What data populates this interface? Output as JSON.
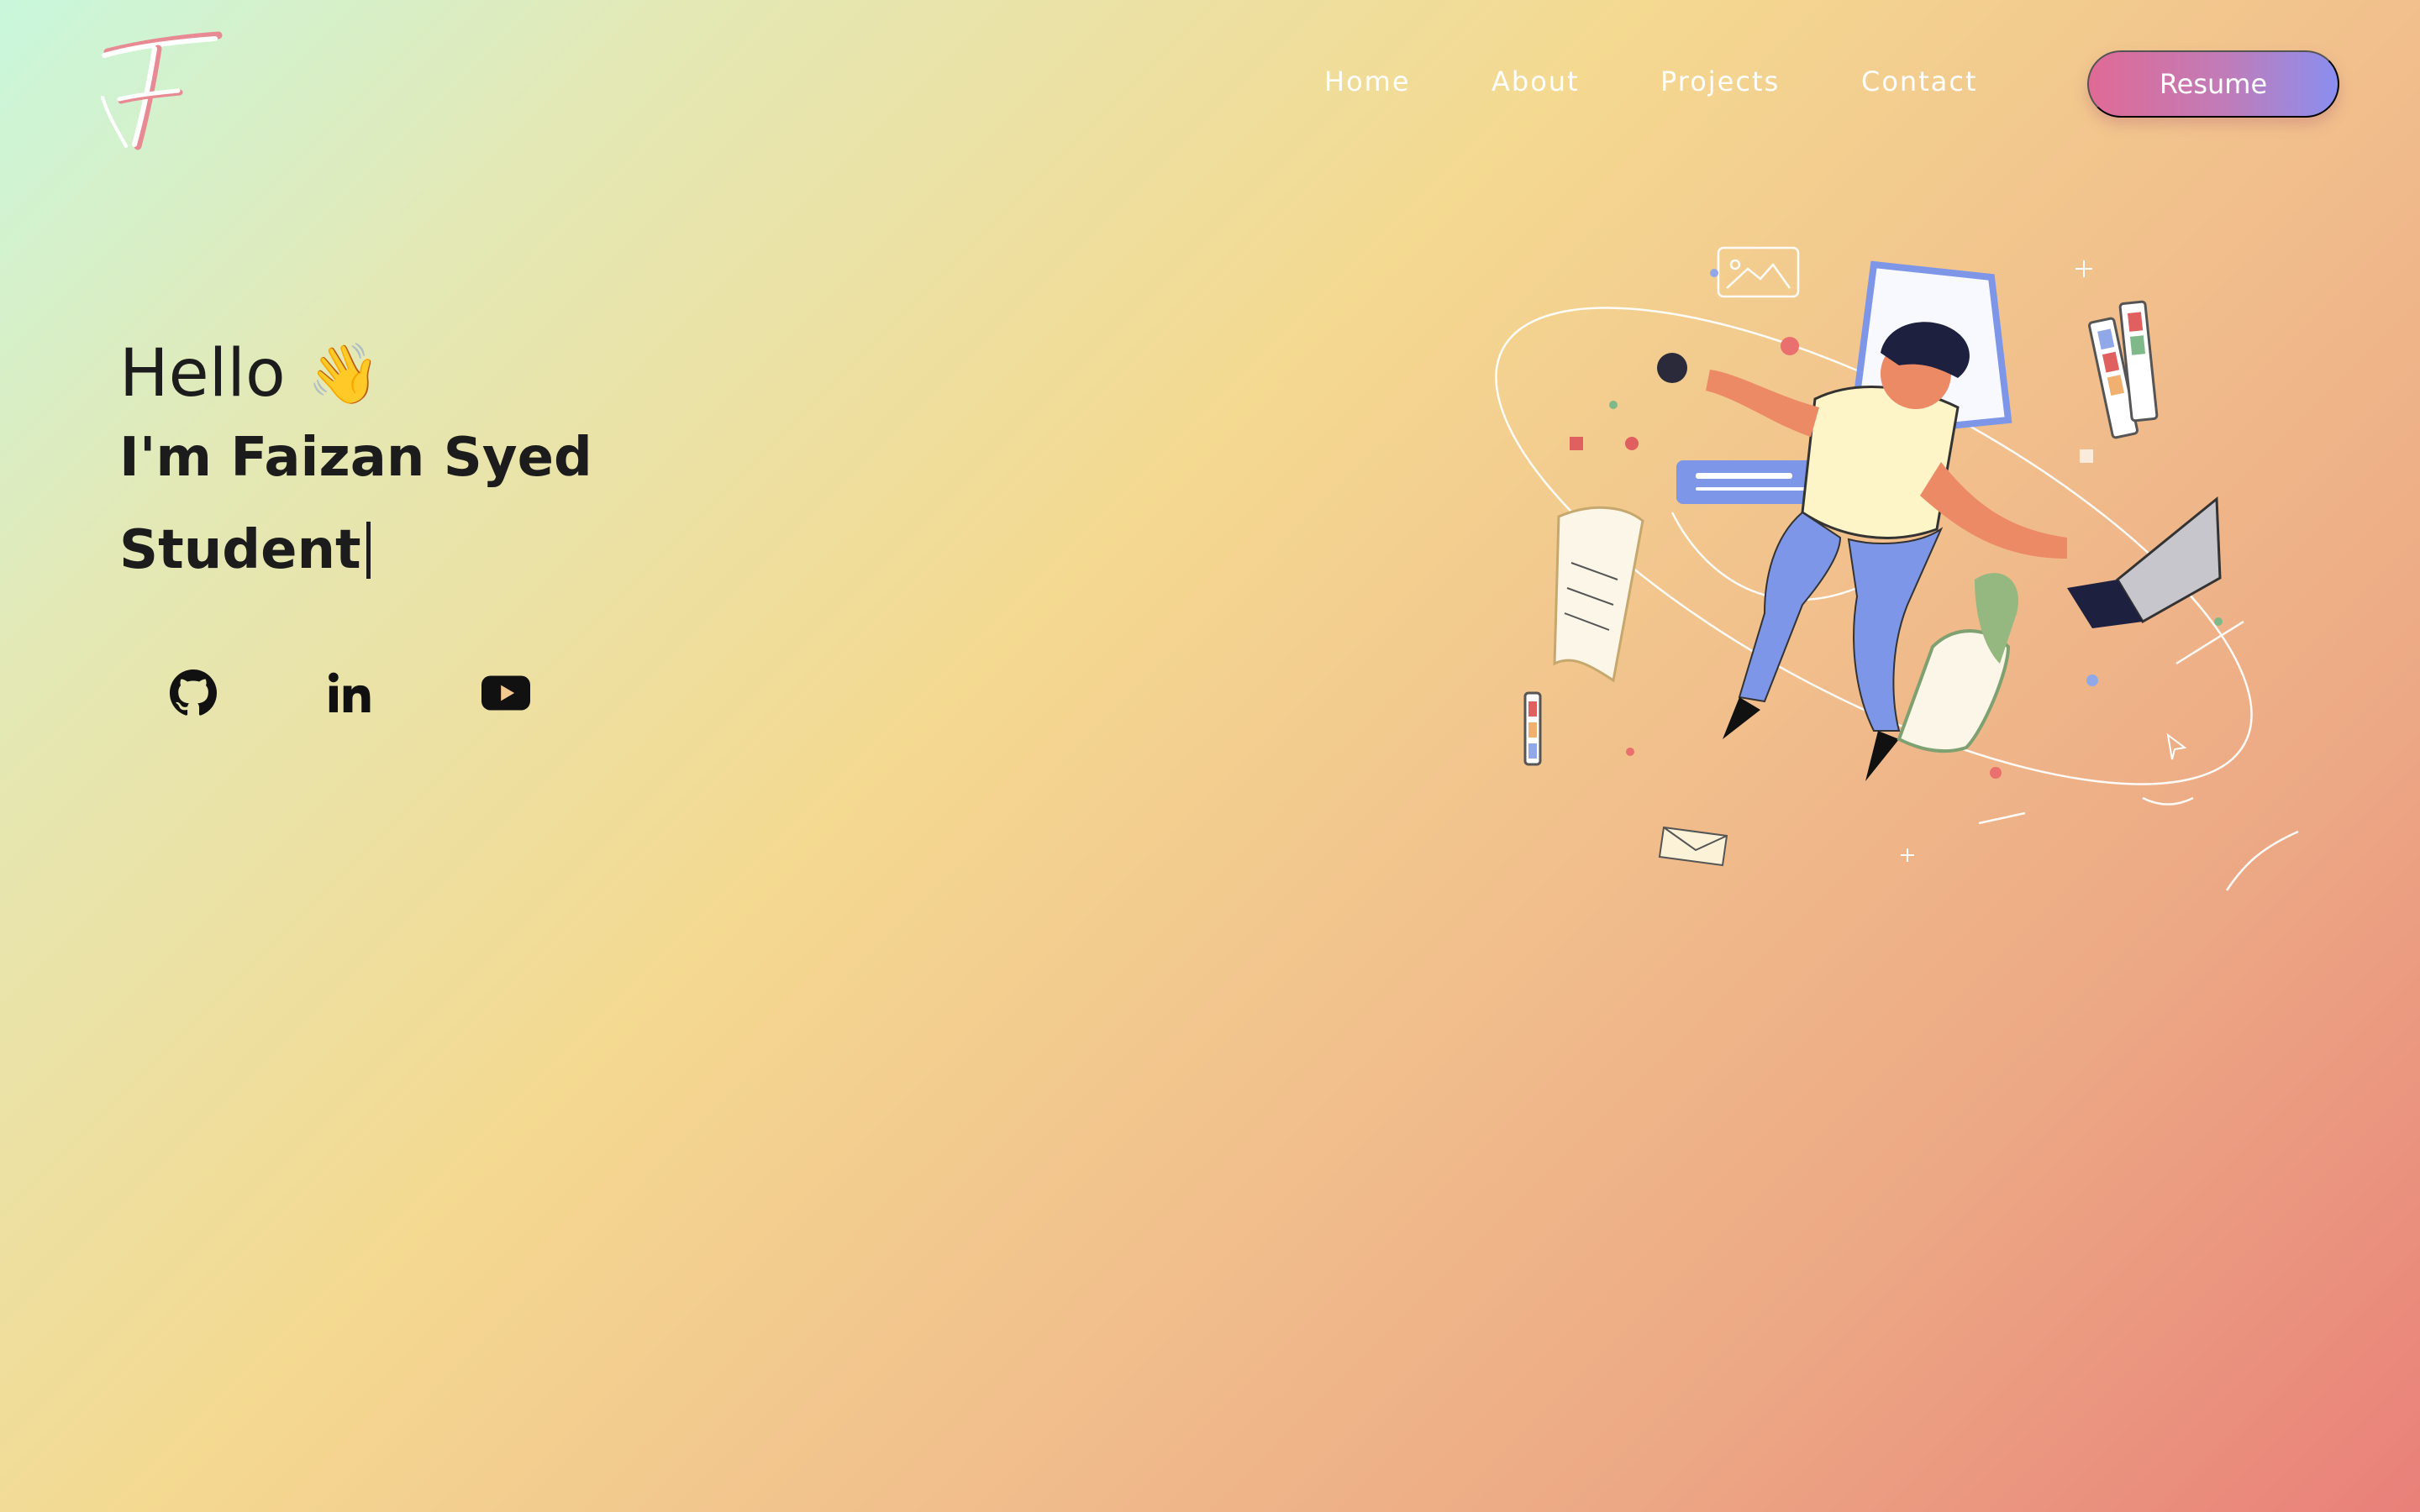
{
  "logo": {
    "letter": "F",
    "icon": "signature-f-logo"
  },
  "nav": {
    "items": [
      {
        "label": "Home"
      },
      {
        "label": "About"
      },
      {
        "label": "Projects"
      },
      {
        "label": "Contact"
      }
    ],
    "resume_label": "Resume"
  },
  "hero": {
    "greeting": "Hello",
    "wave": "👋",
    "name": "I'm Faizan Syed",
    "role": "Student"
  },
  "socials": [
    {
      "icon": "github-icon"
    },
    {
      "icon": "linkedin-icon"
    },
    {
      "icon": "youtube-icon"
    }
  ],
  "illustration": {
    "icon": "developer-illustration"
  },
  "colors": {
    "resume_gradient_start": "#e06a95",
    "resume_gradient_end": "#8a8ef0",
    "text": "#1c1c1c",
    "nav_text": "#ffffff"
  }
}
